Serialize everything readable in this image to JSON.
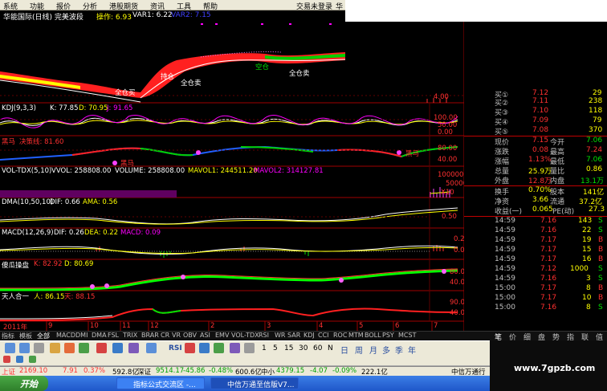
{
  "menu": [
    "系统",
    "功能",
    "报价",
    "分析",
    "港股期货",
    "资讯",
    "工具",
    "帮助"
  ],
  "menu_right": "交易未登录",
  "menu_right2": "华",
  "title": {
    "stock": "华能国际(日线) 完美波段",
    "op_label": "操作: 6.93",
    "var1_label": "VAR1: 6.22",
    "var2_label": "VAR2: 7.15"
  },
  "chart_labels": {
    "price_ann_1": "全仓买",
    "price_ann_2": "全仓卖",
    "price_ann_3": "持仓",
    "price_ann_4": "空仓",
    "price_ann_5": "全仓卖",
    "price_axis_1": "4.00",
    "kdj_title": "KDJ(9,3,3)",
    "kdj_k": "K: 77.85",
    "kdj_d": "D: 70.95",
    "kdj_j": "J: 91.65",
    "kdj_axis_1": "100.00",
    "kdj_axis_2": "50.00",
    "kdj_axis_3": "0.00",
    "hm_title": "黑马",
    "hm_line": "决策线: 81.60",
    "hm_tag1": "黑马",
    "hm_tag2": "黑马",
    "hm_axis_1": "80.00",
    "hm_axis_2": "40.00",
    "vol_title": "VOL-TDX(5,10)",
    "vol_v": "VVOL: 258808.00",
    "vol_volume": "VOLUME: 258808.00",
    "vol_ma1": "MAVOL1: 244511.20",
    "vol_ma2": "MAVOL2: 314127.81",
    "vol_axis_1": "100000",
    "vol_axis_2": "50000",
    "vol_axis_3": "X10",
    "dma_title": "DMA(10,50,10)",
    "dma_dif": "DIF: 0.66",
    "dma_ama": "AMA: 0.56",
    "dma_axis_1": "0.50",
    "macd_title": "MACD(12,26,9)",
    "macd_dif": "DIF: 0.26",
    "macd_dea": "DEA: 0.22",
    "macd_macd": "MACD: 0.09",
    "macd_axis_1": "0.25",
    "macd_axis_2": "0.00",
    "yg_title": "傻瓜操盘",
    "yg_k": "K: 82.92",
    "yg_d": "D: 80.69",
    "yg_axis_1": "80.00",
    "yg_axis_2": "40.00",
    "th_title": "天人合一",
    "th_ren": "人: 86.15",
    "th_tian": "天: 88.15",
    "th_axis_1": "90.00",
    "th_axis_2": "40.00",
    "year": "2011年",
    "months": [
      "9",
      "10",
      "11",
      "12",
      "2",
      "3",
      "4",
      "5",
      "6",
      "7"
    ],
    "daily": "日线"
  },
  "quote": {
    "bids": [
      {
        "label": "买①",
        "price": "7.12",
        "vol": "29"
      },
      {
        "label": "买②",
        "price": "7.11",
        "vol": "238"
      },
      {
        "label": "买③",
        "price": "7.10",
        "vol": "118"
      },
      {
        "label": "买④",
        "price": "7.09",
        "vol": "79"
      },
      {
        "label": "买⑤",
        "price": "7.08",
        "vol": "370"
      }
    ],
    "stats": [
      {
        "l1": "现价",
        "v1": "7.15",
        "l2": "今开",
        "v2": "7.06"
      },
      {
        "l1": "涨跌",
        "v1": "0.08",
        "l2": "最高",
        "v2": "7.24"
      },
      {
        "l1": "涨幅",
        "v1": "1.13%",
        "l2": "最低",
        "v2": "7.06"
      },
      {
        "l1": "总量",
        "v1": "25.9万",
        "l2": "量比",
        "v2": "0.86"
      },
      {
        "l1": "外盘",
        "v1": "12.8万",
        "l2": "内盘",
        "v2": "13.1万"
      }
    ],
    "stats2": [
      {
        "l1": "换手",
        "v1": "0.70%",
        "l2": "股本",
        "v2": "141亿"
      },
      {
        "l1": "净资",
        "v1": "3.66",
        "l2": "流通",
        "v2": "37.2亿"
      },
      {
        "l1": "收益(一)",
        "v1": "0.065",
        "l2": "PE(动)",
        "v2": "27.3"
      }
    ],
    "ticks": [
      {
        "time": "14:59",
        "price": "7.16",
        "vol": "143",
        "side": "S"
      },
      {
        "time": "14:59",
        "price": "7.16",
        "vol": "22",
        "side": "S"
      },
      {
        "time": "14:59",
        "price": "7.17",
        "vol": "19",
        "side": "B"
      },
      {
        "time": "14:59",
        "price": "7.17",
        "vol": "15",
        "side": "B"
      },
      {
        "time": "14:59",
        "price": "7.17",
        "vol": "16",
        "side": "B"
      },
      {
        "time": "14:59",
        "price": "7.12",
        "vol": "1000",
        "side": "S"
      },
      {
        "time": "14:59",
        "price": "7.16",
        "vol": "3",
        "side": "S"
      },
      {
        "time": "15:00",
        "price": "7.17",
        "vol": "8",
        "side": "B"
      },
      {
        "time": "15:00",
        "price": "7.17",
        "vol": "10",
        "side": "B"
      },
      {
        "time": "15:00",
        "price": "7.16",
        "vol": "8",
        "side": "S"
      }
    ]
  },
  "tabs": [
    "指标",
    "模板",
    "全部",
    "MACD",
    "DMI",
    "DMA",
    "FSL",
    "TRIX",
    "BRAR",
    "CR",
    "VR",
    "OBV",
    "ASI",
    "EMV",
    "VOL-TDX",
    "RSI",
    "WR",
    "SAR",
    "KDJ",
    "CCI",
    "ROC",
    "MTM",
    "BOLL",
    "PSY",
    "MCST"
  ],
  "right_tabs": [
    "笔",
    "价",
    "细",
    "盘",
    "势",
    "指",
    "联",
    "值"
  ],
  "toolbar": {
    "rsi": "RSI",
    "periods": [
      "1",
      "5",
      "15",
      "30",
      "60",
      "N"
    ],
    "period_labels": [
      "日",
      "周",
      "月",
      "多",
      "季",
      "年"
    ]
  },
  "index_line": {
    "sh_label": "上证",
    "sh_val": "2169.10",
    "sh_chg": "7.91",
    "sh_pct": "0.37%",
    "sh_amt": "592.8亿",
    "sz_label": "深证",
    "sz_val": "9514.17",
    "sz_chg": "-45.86",
    "sz_pct": "-0.48%",
    "sz_amt": "600.6亿",
    "zx_label": "中小",
    "zx_val": "4379.15",
    "zx_chg": "-4.07",
    "zx_pct": "-0.09%",
    "zx_amt": "222.1亿",
    "broker": "中信万通行"
  },
  "taskbar": {
    "start": "开始",
    "task1": "指标公式交流区 -...",
    "task2": "中信万通至信版V7..."
  },
  "watermark": "www.7gpzb.com",
  "colors": {
    "bg": "#000000",
    "red": "#ff3030",
    "green": "#00e000",
    "yellow": "#ffff00",
    "white": "#ffffff",
    "magenta": "#ff00ff",
    "cyan": "#00ffff"
  }
}
